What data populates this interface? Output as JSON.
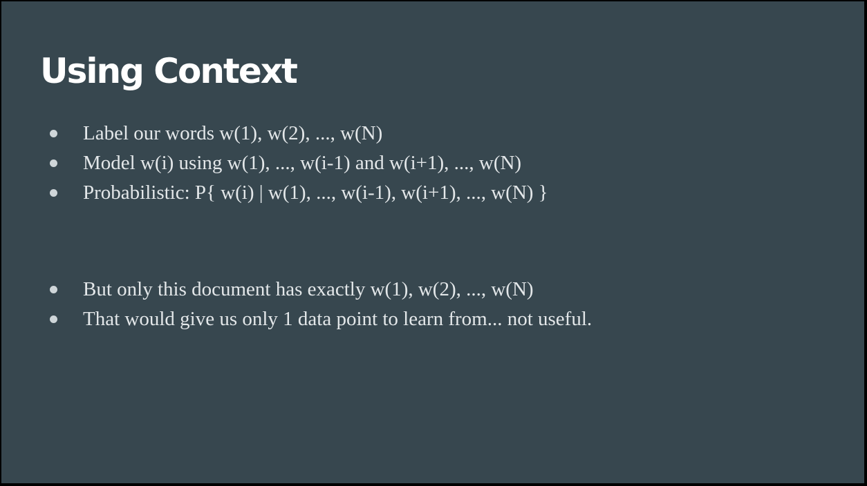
{
  "title": "Using Context",
  "bullets_group_1": [
    "Label our words w(1), w(2), ..., w(N)",
    "Model w(i) using w(1), ..., w(i-1) and w(i+1), ..., w(N)",
    "Probabilistic: P{ w(i) | w(1), ..., w(i-1), w(i+1), ..., w(N) }"
  ],
  "bullets_group_2": [
    "But only this document has exactly w(1), w(2), ..., w(N)",
    "That would give us only 1 data point to learn from... not useful."
  ],
  "colors": {
    "background": "#37474f",
    "title": "#ffffff",
    "text": "#e3e7e9",
    "bullet_dot": "#cfd6d9"
  },
  "icons": {
    "bullet": "bullet-dot-icon"
  }
}
